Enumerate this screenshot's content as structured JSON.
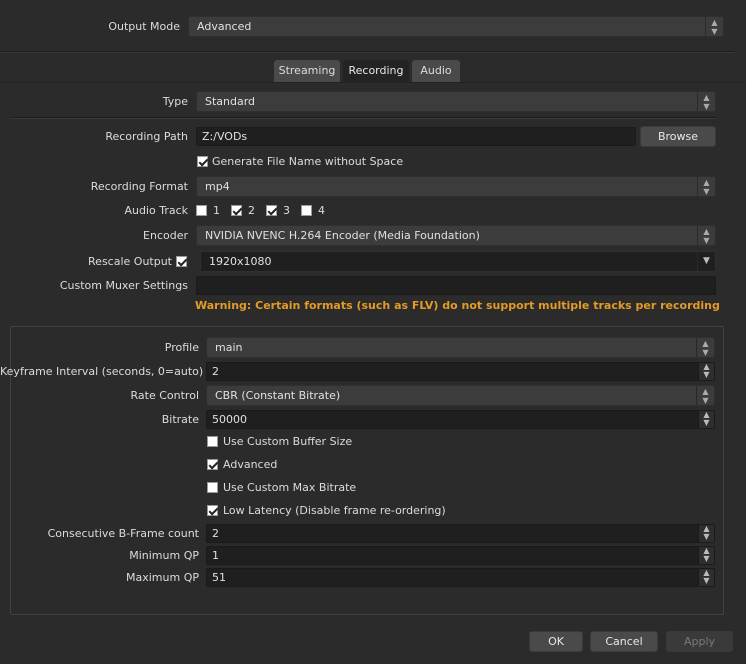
{
  "output": {
    "mode_label": "Output Mode",
    "mode_value": "Advanced"
  },
  "tabs": [
    "Streaming",
    "Recording",
    "Audio"
  ],
  "recording": {
    "type_label": "Type",
    "type_value": "Standard",
    "path_label": "Recording Path",
    "path_value": "Z:/VODs",
    "browse_label": "Browse",
    "generate_label": "Generate File Name without Space",
    "generate_checked": true,
    "format_label": "Recording Format",
    "format_value": "mp4",
    "audio_track_label": "Audio Track",
    "tracks": [
      {
        "label": "1",
        "checked": false
      },
      {
        "label": "2",
        "checked": true
      },
      {
        "label": "3",
        "checked": true
      },
      {
        "label": "4",
        "checked": false
      }
    ],
    "encoder_label": "Encoder",
    "encoder_value": "NVIDIA NVENC H.264 Encoder (Media Foundation)",
    "rescale_label": "Rescale Output",
    "rescale_checked": true,
    "rescale_value": "1920x1080",
    "muxer_label": "Custom Muxer Settings",
    "muxer_value": "",
    "warning": "Warning: Certain formats (such as FLV) do not support multiple tracks per recording"
  },
  "encoder_settings": {
    "profile_label": "Profile",
    "profile_value": "main",
    "keyframe_label": "Keyframe Interval (seconds, 0=auto)",
    "keyframe_value": "2",
    "rate_label": "Rate Control",
    "rate_value": "CBR (Constant Bitrate)",
    "bitrate_label": "Bitrate",
    "bitrate_value": "50000",
    "options": [
      {
        "label": "Use Custom Buffer Size",
        "checked": false
      },
      {
        "label": "Advanced",
        "checked": true
      },
      {
        "label": "Use Custom Max Bitrate",
        "checked": false
      },
      {
        "label": "Low Latency (Disable frame re-ordering)",
        "checked": true
      }
    ],
    "bframe_label": "Consecutive B-Frame count",
    "bframe_value": "2",
    "minqp_label": "Minimum QP",
    "minqp_value": "1",
    "maxqp_label": "Maximum QP",
    "maxqp_value": "51"
  },
  "footer": {
    "ok": "OK",
    "cancel": "Cancel",
    "apply": "Apply"
  },
  "icons": {
    "spin_up": "▲",
    "spin_down": "▼",
    "combo_arrows": "⌃⌄",
    "dropdown": "⌄"
  },
  "colors": {
    "background": "#2b2b2b",
    "warning": "#e39b26",
    "field": "#1f1f1f"
  }
}
